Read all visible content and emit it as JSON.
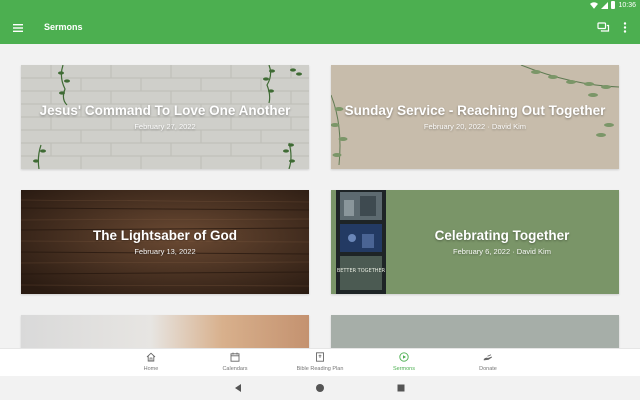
{
  "status_bar": {
    "time": "10:36"
  },
  "app_bar": {
    "title": "Sermons"
  },
  "colors": {
    "primary": "#4caf50",
    "active_nav": "#4caf50"
  },
  "sermons": [
    {
      "title": "Jesus' Command To Love One Another",
      "subtitle": "February 27, 2022"
    },
    {
      "title": "Sunday Service - Reaching Out Together",
      "subtitle": "February 20, 2022 · David Kim"
    },
    {
      "title": "The Lightsaber of God",
      "subtitle": "February 13, 2022"
    },
    {
      "title": "Celebrating Together",
      "subtitle": "February 6, 2022 · David Kim"
    }
  ],
  "photo_strip_caption": "BETTER TOGETHER",
  "bottom_nav": [
    {
      "label": "Home",
      "icon": "home-icon"
    },
    {
      "label": "Calendars",
      "icon": "calendar-icon"
    },
    {
      "label": "Bible Reading Plan",
      "icon": "book-icon"
    },
    {
      "label": "Sermons",
      "icon": "sermons-icon",
      "active": true
    },
    {
      "label": "Donate",
      "icon": "donate-icon"
    }
  ]
}
